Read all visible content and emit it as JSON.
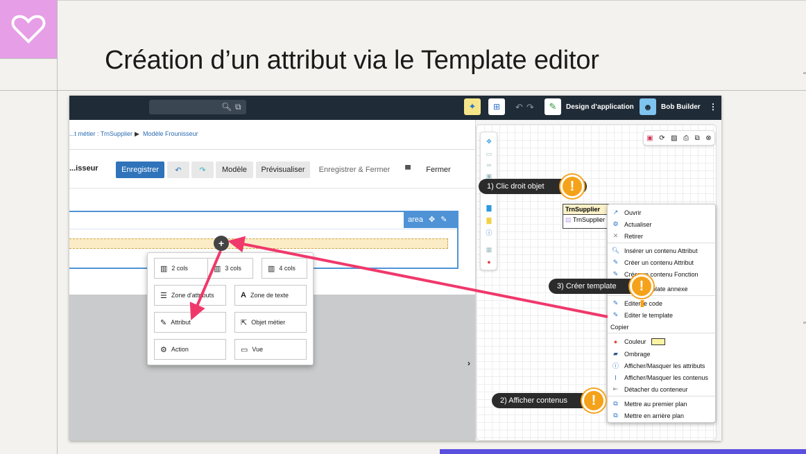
{
  "slide": {
    "title": "Création d’un attribut via le Template editor"
  },
  "app": {
    "topbar": {
      "app_name": "Design d’application",
      "user_name": "Bob Builder"
    },
    "breadcrumb": {
      "item1": "...t métier : TrnSupplier",
      "separator": "▶",
      "item2": "Modèle Frounisseur"
    },
    "editor": {
      "title": "...isseur",
      "buttons": {
        "save": "Enregistrer",
        "model": "Modèle",
        "preview": "Prévisualiser",
        "save_close": "Enregistrer & Fermer",
        "close": "Fermer"
      },
      "area_label": "area"
    },
    "insert_menu": {
      "items": [
        {
          "icon": "columns-icon",
          "label": "2 cols"
        },
        {
          "icon": "columns-icon",
          "label": "3 cols"
        },
        {
          "icon": "columns-icon",
          "label": "4 cols"
        },
        {
          "icon": "list-icon",
          "label": "Zone d'attributs"
        },
        {
          "icon": "text-icon",
          "label": "Zone de texte"
        },
        {
          "icon": "edit-icon",
          "label": "Attribut"
        },
        {
          "icon": "external-icon",
          "label": "Objet métier"
        },
        {
          "icon": "gear-icon",
          "label": "Action"
        },
        {
          "icon": "window-icon",
          "label": "Vue"
        }
      ]
    },
    "diagram": {
      "class_box": {
        "name": "TrnSupplier",
        "row": "TrnSupplier"
      },
      "context_menu": [
        {
          "label": "Ouvrir",
          "icon": "open-icon"
        },
        {
          "label": "Actualiser",
          "icon": "refresh-icon"
        },
        {
          "label": "Retirer",
          "icon": "close-icon"
        },
        {
          "label": "Insérer un contenu Attribut",
          "icon": "search-icon"
        },
        {
          "label": "Créer un contenu Attribut",
          "icon": "edit-icon"
        },
        {
          "label": "Créer un contenu Fonction",
          "icon": "edit-icon"
        },
        {
          "label": "Créer template annexe",
          "icon": "template-icon"
        },
        {
          "label": "Editer le code",
          "icon": "edit-icon"
        },
        {
          "label": "Editer le template",
          "icon": "edit-icon"
        },
        {
          "label": "Copier",
          "icon": ""
        },
        {
          "label": "Couleur",
          "icon": "color-icon"
        },
        {
          "label": "Ombrage",
          "icon": "shadow-icon"
        },
        {
          "label": "Afficher/Masquer les attributs",
          "icon": "info-icon"
        },
        {
          "label": "Afficher/Masquer les contenus",
          "icon": "cursor-icon"
        },
        {
          "label": "Détacher du conteneur",
          "icon": "detach-icon"
        },
        {
          "label": "Mettre au premier plan",
          "icon": "front-icon"
        },
        {
          "label": "Mettre en arrière plan",
          "icon": "back-icon"
        }
      ],
      "callouts": {
        "step1": "1)  Clic droit objet",
        "step2": "2) Afficher contenus",
        "step3": "3) Créer template"
      },
      "warning_glyph": "!"
    },
    "colors": {
      "primary": "#2f73ba",
      "topbar": "#1f2b36",
      "arrow": "#f0386b",
      "warning": "#f5a21b",
      "slide_accent": "#e69ee6",
      "bottom_bar": "#5b4fe0"
    }
  }
}
